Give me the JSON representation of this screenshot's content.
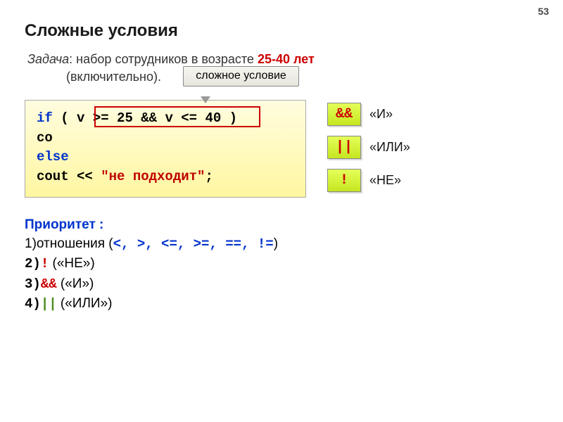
{
  "page_number": "53",
  "title": "Сложные условия",
  "task_prefix": "Задача",
  "task_text1": ": набор сотрудников в возрасте ",
  "task_age": "25-40 лет",
  "task_text2": "(включительно).",
  "callout": "сложное условие",
  "code": {
    "if": "if",
    "open_paren": "(",
    "cond": " v >= 25 && v <= 40 ",
    "close_paren": ")",
    "cout_stub": "co",
    "else": "else",
    "cout2": "  cout << ",
    "str2": "\"не подходит\"",
    "semi": ";"
  },
  "ops": {
    "and_sym": "&&",
    "and_label": "«И»",
    "or_sym": "||",
    "or_label": "«ИЛИ»",
    "not_sym": "!",
    "not_label": "«НЕ»"
  },
  "priority": {
    "header": "Приоритет :",
    "p1a": "1)",
    "p1b": "отношения (",
    "p1ops": "<, >, <=, >=, ==, !=",
    "p1c": ")",
    "p2a": "2)",
    "p2b": "!",
    "p2c": " («НЕ»)",
    "p3a": "3)",
    "p3b": "&&",
    "p3c": " («И»)",
    "p4a": "4)",
    "p4b": "||",
    "p4c": " («ИЛИ»)"
  }
}
